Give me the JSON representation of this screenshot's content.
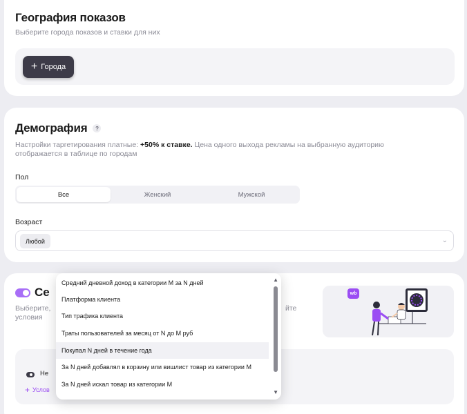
{
  "geography": {
    "title": "География показов",
    "subtitle": "Выберите города показов и ставки для них",
    "add_city_label": "Города"
  },
  "demography": {
    "title": "Демография",
    "help": "?",
    "desc_prefix": "Настройки таргетирования платные: ",
    "desc_bold": "+50% к ставке.",
    "desc_suffix": " Цена одного выхода рекламы на выбранную аудиторию",
    "desc_line2": "отображается в таблице по городам",
    "gender_label": "Пол",
    "gender_options": [
      "Все",
      "Женский",
      "Мужской"
    ],
    "gender_selected": "Все",
    "age_label": "Возраст",
    "age_value": "Любой"
  },
  "segments": {
    "title_visible": "Се",
    "desc_line1_visible": "Выберите,",
    "desc_line2_visible": "условия",
    "desc_tail_visible": "йте",
    "logo_text": "wb",
    "radio_label_visible": "Не",
    "add_condition_visible": "Услов"
  },
  "dropdown": {
    "items": [
      "Средний дневной доход в категории M за N дней",
      "Платформа клиента",
      "Тип трафика клиента",
      "Траты пользователей за месяц от N до M руб",
      "Покупал N дней в течение года",
      "За N дней добавлял в корзину или вишлист товар из категории M",
      "За N дней искал товар из категории M"
    ],
    "hovered_index": 4
  },
  "colors": {
    "accent": "#9b4df3",
    "toggle": "#a86ef7",
    "dark_button": "#3d3b48",
    "page_bg": "#ededf2"
  }
}
